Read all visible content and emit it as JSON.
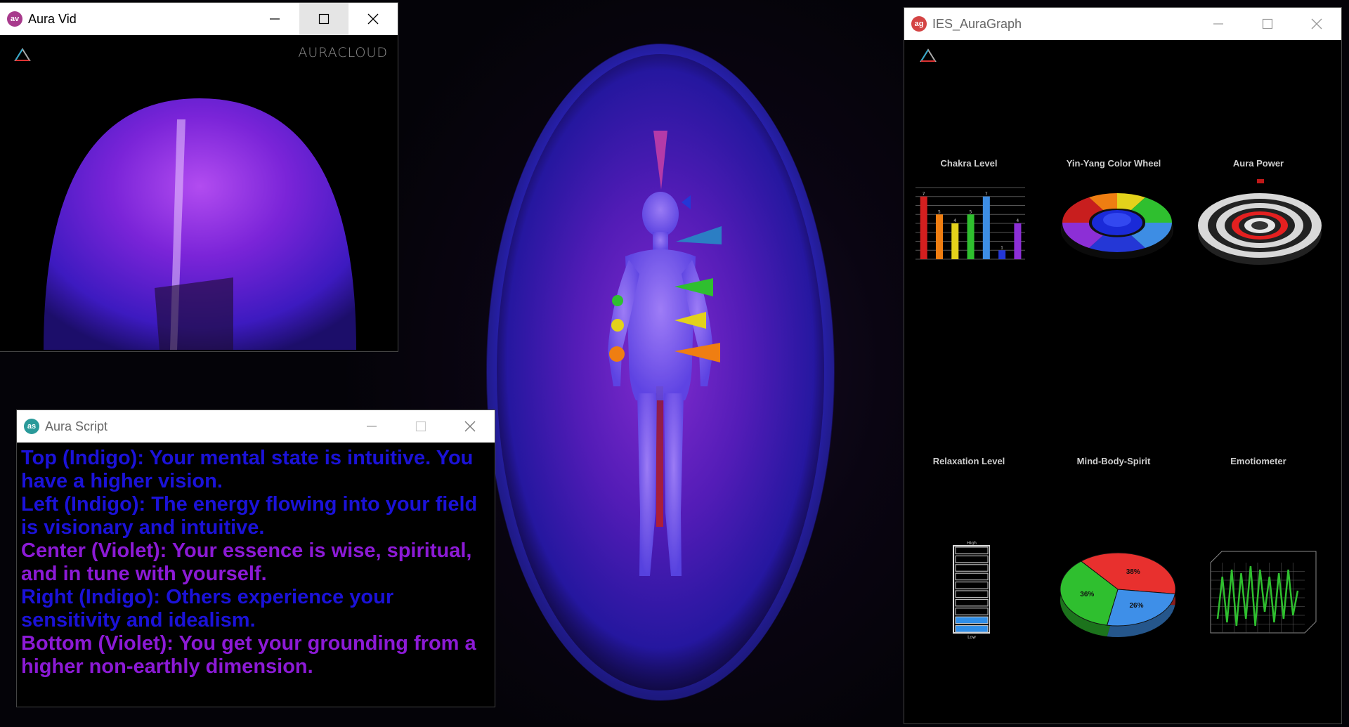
{
  "central_visual": {
    "label": "aura-body-visualization"
  },
  "aura_vid": {
    "title": "Aura Vid",
    "icon_text": "av",
    "brand_logo": "AURACLOUD",
    "controls": [
      "minimize",
      "maximize",
      "close"
    ]
  },
  "aura_script": {
    "title": "Aura Script",
    "icon_text": "as",
    "lines": [
      {
        "text": "Top (Indigo): Your mental state is intuitive. You have a higher vision.",
        "color": "#1b12d8"
      },
      {
        "text": "Left (Indigo): The energy flowing into your field is visionary and intuitive.",
        "color": "#1b12d8"
      },
      {
        "text": "Center (Violet): Your essence is wise, spiritual, and in tune with yourself.",
        "color": "#8c1ad6"
      },
      {
        "text": "Right (Indigo): Others experience your sensitivity and idealism.",
        "color": "#1b12d8"
      },
      {
        "text": "Bottom (Violet): You get your grounding from a higher non-earthly dimension.",
        "color": "#8c1ad6"
      }
    ]
  },
  "auragraph": {
    "title": "IES_AuraGraph",
    "icon_text": "ag",
    "widgets": {
      "chakra_level": "Chakra Level",
      "yin_yang_color_wheel": "Yin-Yang Color Wheel",
      "aura_power": "Aura Power",
      "relaxation_level": "Relaxation Level",
      "mind_body_spirit": "Mind-Body-Spirit",
      "emotiometer": "Emotiometer"
    }
  },
  "chart_data": [
    {
      "type": "bar",
      "title": "Chakra Level",
      "values": [
        7,
        5,
        4,
        5,
        7,
        1,
        4
      ],
      "data_labels": [
        "7",
        "5",
        "4",
        "5",
        "7",
        "1",
        "4"
      ],
      "colors": [
        "#d31f1f",
        "#ef7e12",
        "#e3d21b",
        "#2fbf2f",
        "#3d8de4",
        "#2437d6",
        "#8c2fd6"
      ],
      "ylim": [
        0,
        8
      ]
    },
    {
      "type": "pie",
      "title": "Mind-Body-Spirit",
      "labels": [
        "38%",
        "26%",
        "36%"
      ],
      "values": [
        38,
        26,
        36
      ],
      "colors": [
        "#e8302e",
        "#3e8fe8",
        "#2fbf2f"
      ]
    },
    {
      "type": "bar",
      "title": "Relaxation Level",
      "axis_top_label": "High",
      "axis_bottom_label": "Low",
      "value_fraction": 0.2,
      "segments": 10
    },
    {
      "type": "line",
      "title": "Emotiometer",
      "x": [
        0,
        1,
        2,
        3,
        4,
        5,
        6,
        7,
        8,
        9,
        10,
        11,
        12,
        13,
        14,
        15,
        16,
        17
      ],
      "y": [
        0.2,
        0.8,
        0.15,
        0.9,
        0.1,
        0.85,
        0.2,
        0.95,
        0.1,
        0.9,
        0.3,
        0.8,
        0.15,
        0.85,
        0.2,
        0.9,
        0.25,
        0.6
      ],
      "color": "#2fbf2f"
    }
  ]
}
